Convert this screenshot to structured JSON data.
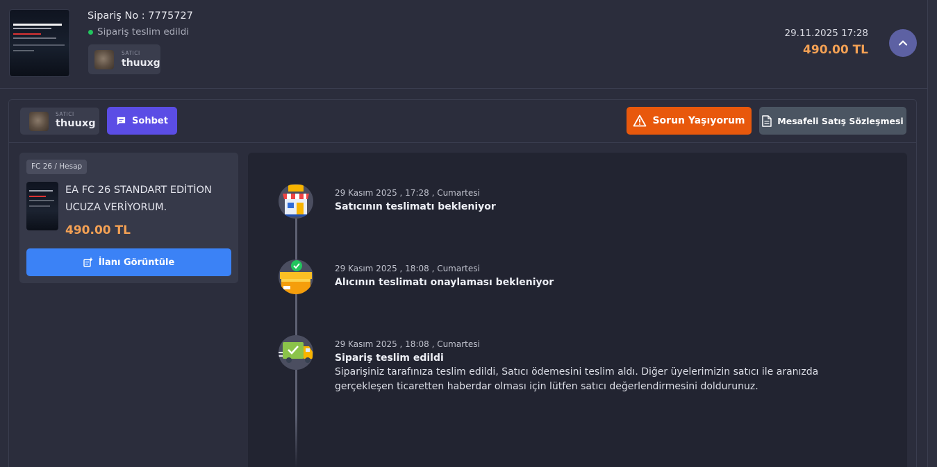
{
  "order": {
    "order_no": "Sipariş No : 7775727",
    "status": "Sipariş teslim edildi",
    "seller_tag": "SATICI",
    "seller_name": "thuuxg",
    "date": "29.11.2025 17:28",
    "price": "490.00 TL",
    "status_color": "#22c55e",
    "price_color": "#f4a154"
  },
  "detail": {
    "seller_tag": "SATICI",
    "seller_name": "thuuxg",
    "chat_label": "Sohbet",
    "issue_label": "Sorun Yaşıyorum",
    "contract_label": "Mesafeli Satış Sözleşmesi",
    "chat_color": "#5b4de5",
    "issue_color": "#e8580c"
  },
  "product": {
    "category": "FC 26 / Hesap",
    "title": "EA FC 26 STANDART EDİTİON UCUZA VERİYORUM.",
    "price": "490.00 TL",
    "view_label": "İlanı Görüntüle",
    "view_color": "#3b82f6"
  },
  "timeline": [
    {
      "icon": "store-icon",
      "date": "29 Kasım 2025 , 17:28 , Cumartesi",
      "title": "Satıcının teslimatı bekleniyor",
      "desc": ""
    },
    {
      "icon": "package-check-icon",
      "date": "29 Kasım 2025 , 18:08 , Cumartesi",
      "title": "Alıcının teslimatı onaylaması bekleniyor",
      "desc": ""
    },
    {
      "icon": "delivery-truck-icon",
      "date": "29 Kasım 2025 , 18:08 , Cumartesi",
      "title": "Sipariş teslim edildi",
      "desc": "Siparişiniz tarafınıza teslim edildi, Satıcı ödemesini teslim aldı. Diğer üyelerimizin satıcı ile aranızda gerçekleşen ticaretten haberdar olması için lütfen satıcı değerlendirmesini doldurunuz."
    }
  ]
}
